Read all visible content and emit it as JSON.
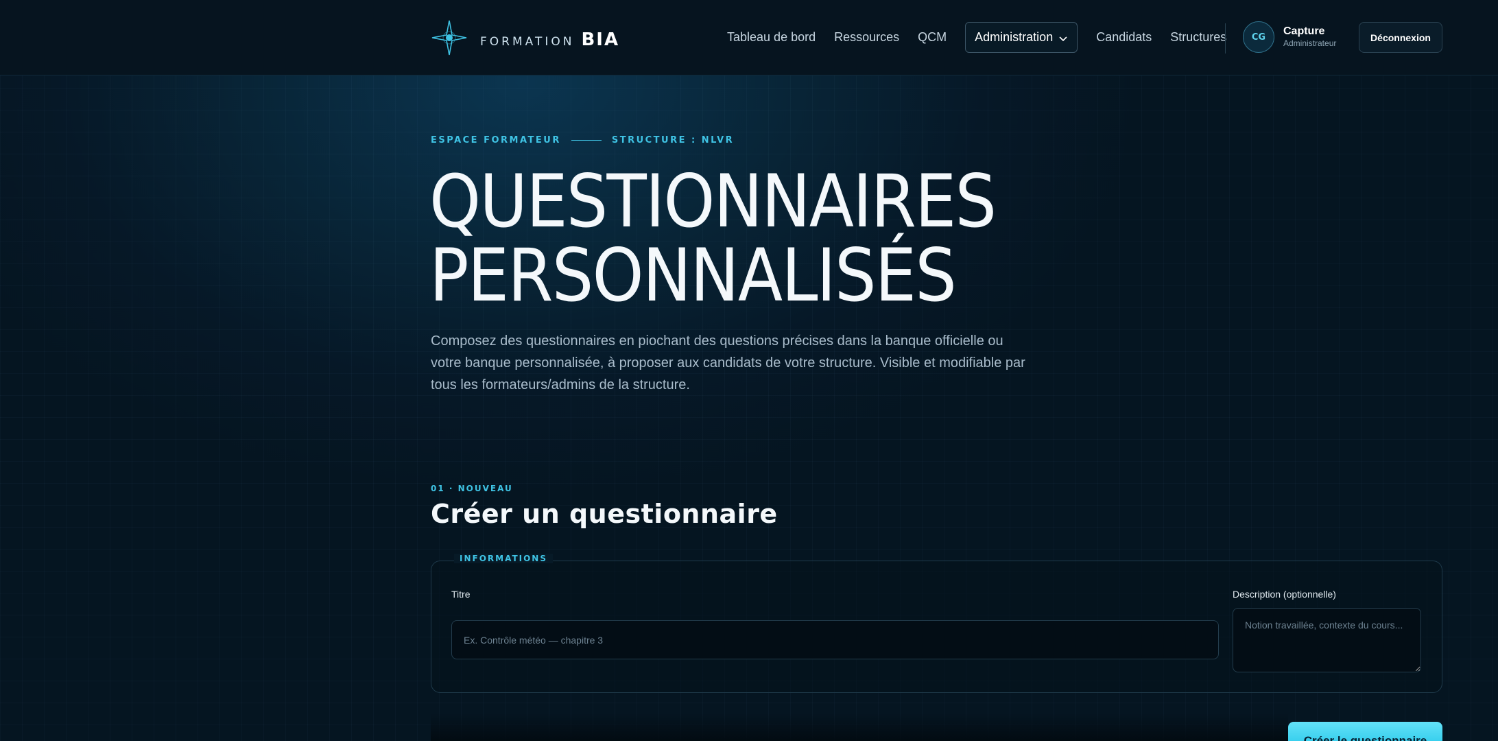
{
  "header": {
    "logo": {
      "word": "FORMATION",
      "brand": "BIA",
      "icon": "compass-star-icon"
    },
    "nav": [
      {
        "label": "Tableau de bord"
      },
      {
        "label": "Ressources"
      },
      {
        "label": "QCM"
      },
      {
        "label": "Administration",
        "has_dropdown": true,
        "active": true
      },
      {
        "label": "Candidats"
      },
      {
        "label": "Structures"
      }
    ],
    "user": {
      "initials": "CG",
      "name": "Capture",
      "role": "Administrateur"
    },
    "logout_label": "Déconnexion"
  },
  "hero": {
    "eyebrow_left": "ESPACE FORMATEUR",
    "eyebrow_right": "STRUCTURE : NLVR",
    "title_line1": "QUESTIONNAIRES",
    "title_line2": "PERSONNALISÉS",
    "description": "Composez des questionnaires en piochant des questions précises dans la banque officielle ou votre banque personnalisée, à proposer aux candidats de votre structure. Visible et modifiable par tous les formateurs/admins de la structure."
  },
  "create_section": {
    "kicker": "01 · NOUVEAU",
    "title": "Créer un questionnaire",
    "panel_legend": "INFORMATIONS",
    "title_field": {
      "label": "Titre",
      "value": "",
      "placeholder": "Ex. Contrôle météo — chapitre 3"
    },
    "description_field": {
      "label": "Description (optionnelle)",
      "value": "",
      "placeholder": "Notion travaillée, contexte du cours..."
    },
    "submit_label": "Créer le questionnaire"
  },
  "colors": {
    "accent": "#3fc3e4",
    "background": "#061827",
    "button": "#19c1e6"
  }
}
